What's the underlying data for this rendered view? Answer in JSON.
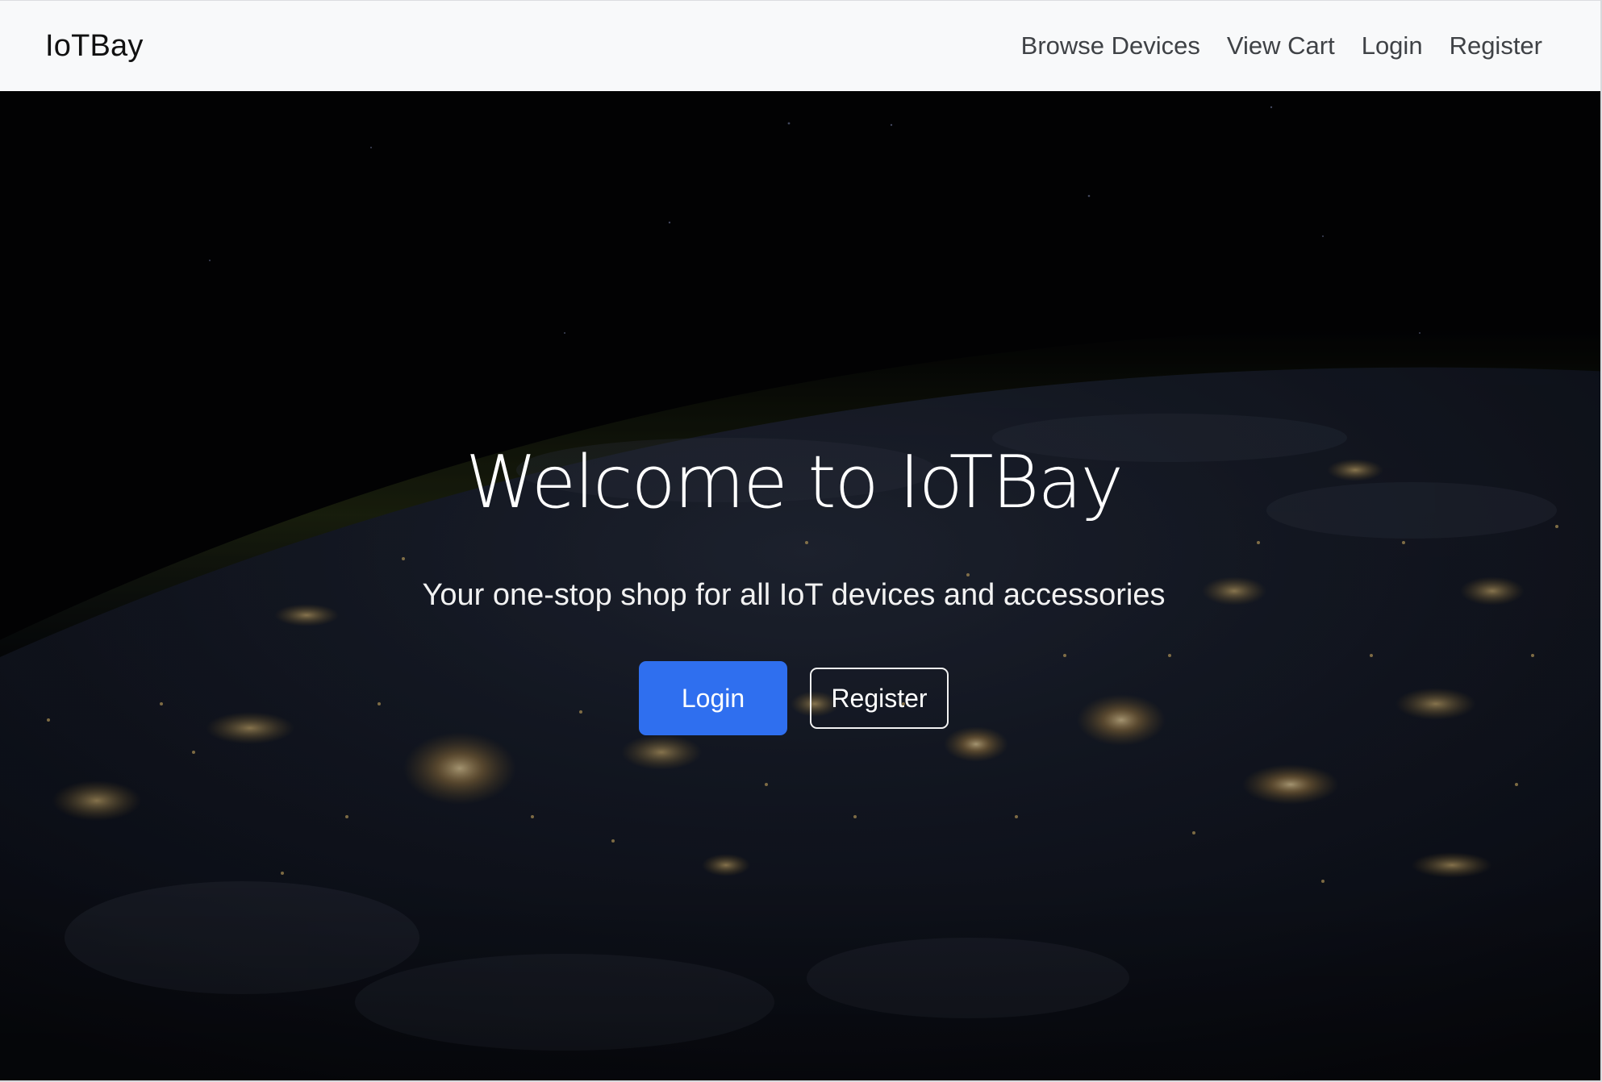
{
  "navbar": {
    "brand": "IoTBay",
    "links": [
      {
        "label": "Browse Devices"
      },
      {
        "label": "View Cart"
      },
      {
        "label": "Login"
      },
      {
        "label": "Register"
      }
    ]
  },
  "hero": {
    "title": "Welcome to IoTBay",
    "subtitle": "Your one-stop shop for all IoT devices and accessories",
    "primary_button": "Login",
    "secondary_button": "Register",
    "background_image": "earth-at-night-from-space",
    "colors": {
      "primary_button": "#2f6fef",
      "overlay": "#000000"
    }
  }
}
